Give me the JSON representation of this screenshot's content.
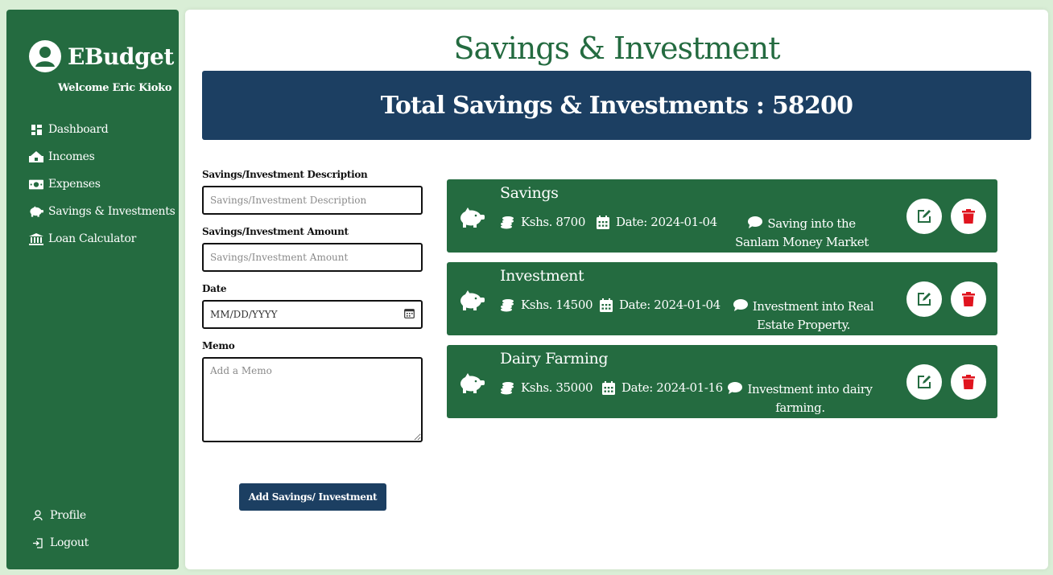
{
  "app": {
    "name": "EBudget",
    "welcome": "Welcome Eric Kioko"
  },
  "sidebar": {
    "items": [
      {
        "label": "Dashboard",
        "icon": "dashboard-icon"
      },
      {
        "label": "Incomes",
        "icon": "incomes-icon"
      },
      {
        "label": "Expenses",
        "icon": "expenses-icon"
      },
      {
        "label": "Savings & Investments",
        "icon": "piggy-bank-icon"
      },
      {
        "label": "Loan Calculator",
        "icon": "bank-icon"
      }
    ],
    "bottom": [
      {
        "label": "Profile",
        "icon": "user-icon"
      },
      {
        "label": "Logout",
        "icon": "logout-icon"
      }
    ]
  },
  "page": {
    "title": "Savings & Investment",
    "total_label": "Total Savings & Investments : 58200"
  },
  "form": {
    "description_label": "Savings/Investment Description",
    "description_placeholder": "Savings/Investment Description",
    "amount_label": "Savings/Investment Amount",
    "amount_placeholder": "Savings/Investment Amount",
    "date_label": "Date",
    "date_placeholder": "MM/DD/YYYY",
    "memo_label": "Memo",
    "memo_placeholder": "Add a Memo",
    "submit_label": "Add Savings/ Investment"
  },
  "entries": [
    {
      "title": "Savings",
      "amount": "Kshs. 8700",
      "date": "Date: 2024-01-04",
      "memo": "Saving into the Sanlam Money Market Fund."
    },
    {
      "title": "Investment",
      "amount": "Kshs. 14500",
      "date": "Date: 2024-01-04",
      "memo": "Investment into Real Estate Property."
    },
    {
      "title": "Dairy Farming",
      "amount": "Kshs. 35000",
      "date": "Date: 2024-01-16",
      "memo": "Investment into dairy farming."
    }
  ],
  "colors": {
    "sidebar_green": "#246b40",
    "banner_navy": "#1c3f62",
    "delete_red": "#e0141e"
  }
}
